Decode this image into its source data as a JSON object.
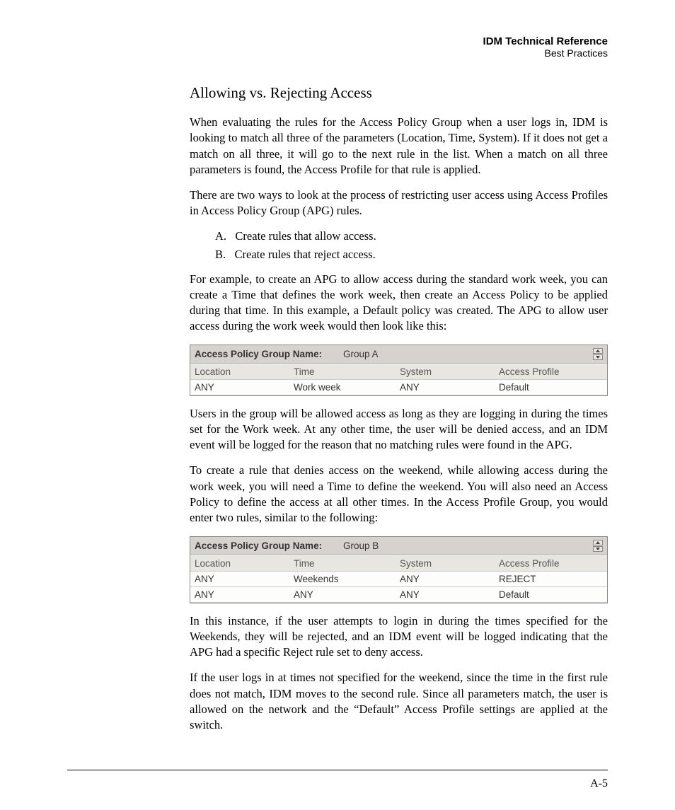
{
  "header": {
    "title": "IDM Technical Reference",
    "section": "Best Practices"
  },
  "page_number": "A-5",
  "section_title": "Allowing vs. Rejecting Access",
  "para1": "When evaluating the rules for the Access Policy Group when a user logs in, IDM is looking to match all three of the parameters (Location, Time, System). If it does not get a match on all three, it will go to the next rule in the list. When a match on all three parameters is found, the Access Profile for that rule is applied.",
  "para2": "There are two ways to look at the process of restricting user access using Access Profiles in Access Policy Group (APG) rules.",
  "list": {
    "a_label": "A.",
    "a_text": "Create rules that allow access.",
    "b_label": "B.",
    "b_text": "Create rules that reject access."
  },
  "para3": "For example, to create an APG to allow access during the standard work week, you can create a Time that defines the work week, then create an Access Policy to be applied during that time. In this example, a Default policy was created. The APG to allow user access during the work week would then look like this:",
  "box1": {
    "label": "Access Policy Group Name:",
    "name": "Group A",
    "headers": {
      "location": "Location",
      "time": "Time",
      "system": "System",
      "profile": "Access Profile"
    },
    "rows": [
      {
        "location": "ANY",
        "time": "Work week",
        "system": "ANY",
        "profile": "Default"
      }
    ]
  },
  "para4": "Users in the group will be allowed access as long as they are logging in during the times set for the Work week. At any other time, the user will be denied access, and an IDM event will be logged for the reason that no matching rules were found in the APG.",
  "para5": "To create a rule that denies access on the weekend, while allowing access during the work week, you will need a Time to define the weekend. You will also need an Access Policy to define the access at all other times. In the Access Profile Group, you would enter two rules, similar to the following:",
  "box2": {
    "label": "Access Policy Group Name:",
    "name": "Group B",
    "headers": {
      "location": "Location",
      "time": "Time",
      "system": "System",
      "profile": "Access Profile"
    },
    "rows": [
      {
        "location": "ANY",
        "time": "Weekends",
        "system": "ANY",
        "profile": "REJECT"
      },
      {
        "location": "ANY",
        "time": "ANY",
        "system": "ANY",
        "profile": "Default"
      }
    ]
  },
  "para6": "In this instance, if the user attempts to login in during the times specified for the Weekends, they will be rejected, and an IDM event will be logged indicating that the APG had a specific Reject rule set to deny access.",
  "para7": "If the user logs in at times not specified for the weekend, since the time in the first rule does not match, IDM moves to the second rule. Since all parameters match, the user is allowed on the network and the “Default” Access Profile settings are applied at the switch."
}
